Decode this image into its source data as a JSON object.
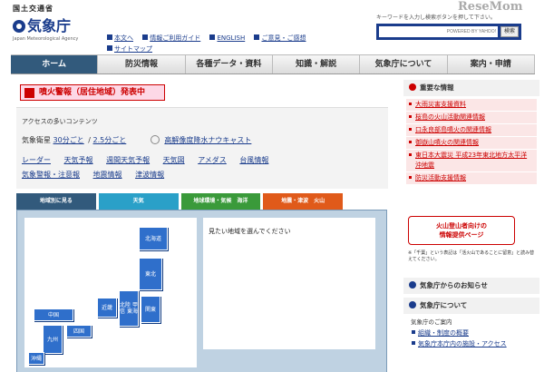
{
  "header": {
    "ministry": "国土交通省",
    "agency": "気象庁",
    "agency_en": "Japan Meteorological Agency",
    "brand": "ReseMom",
    "links": [
      "本文へ",
      "情報ご利用ガイド",
      "ENGLISH",
      "ご意見・ご感想",
      "サイトマップ"
    ],
    "search": {
      "hint": "キーワードを入力し検索ボタンを押して下さい。",
      "placeholder": "POWERED BY YAHOO!",
      "button": "検索"
    }
  },
  "nav": [
    "ホーム",
    "防災情報",
    "各種データ・資料",
    "知識・解説",
    "気象庁について",
    "案内・申請"
  ],
  "alert": "噴火警報（居住地域）発表中",
  "access": {
    "title": "アクセスの多いコンテンツ",
    "sat_label": "気象衛星",
    "sat_30": "30分ごと",
    "sat_sep": "/",
    "sat_25": "2.5分ごと",
    "nowcast": "高解像度降水ナウキャスト",
    "row2": [
      "レーダー",
      "天気予報",
      "週間天気予報",
      "天気図",
      "アメダス",
      "台風情報"
    ],
    "row3": [
      "気象警報・注意報",
      "地震情報",
      "津波情報"
    ]
  },
  "tabs": [
    {
      "label": "地域別に見る",
      "color": "#325a7c"
    },
    {
      "label": "天気",
      "color": "#2aa0c8"
    },
    {
      "label": "地球環境・気候　海洋",
      "color": "#3a9a3a"
    },
    {
      "label": "地震・津波　火山",
      "color": "#e05a1a"
    }
  ],
  "map": {
    "regions": [
      "北海道",
      "東北",
      "関東",
      "北陸 甲信 東海",
      "近畿",
      "中国",
      "四国",
      "九州",
      "沖縄"
    ],
    "prompt": "見たい地域を選んでください"
  },
  "sidebar": {
    "important_title": "重要な情報",
    "important": [
      "大雨災害支援資料",
      "桜島の火山活動関連情報",
      "口永良部島噴火の関連情報",
      "御嶽山噴火の関連情報",
      "東日本大震災 平成23年東北地方太平洋沖地震",
      "防災活動支援情報"
    ],
    "kazan_line1": "火山登山者向けの",
    "kazan_line2": "情報提供ページ",
    "note": "※「千葉」という表記は「活火山であることに留意」と読み替えてください。",
    "news_title": "気象庁からのお知らせ",
    "about_title": "気象庁について",
    "about_sub": "気象庁のご案内",
    "about_links": [
      "組織・制度の概要",
      "気象庁本庁内の施設・アクセス"
    ]
  },
  "colors": {
    "navy": "#1a3c8c",
    "region": "#2f6fcb",
    "alert_red": "#cc0000"
  }
}
